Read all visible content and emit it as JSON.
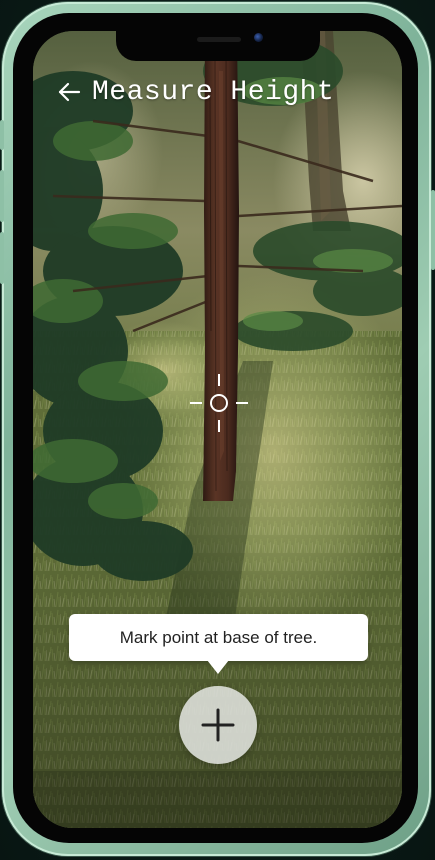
{
  "header": {
    "back_icon": "arrow-left-icon",
    "title": "Measure Height"
  },
  "camera": {
    "scene": "tree-trunk-in-grass",
    "crosshair_icon": "crosshair-icon"
  },
  "instruction": {
    "text": "Mark point at base of tree."
  },
  "add_point": {
    "icon": "plus-icon"
  },
  "colors": {
    "phone_frame": "#9fcdb3",
    "bubble_bg": "#ffffff",
    "bubble_text": "#222222",
    "button_bg": "#e0e2de",
    "icon_dark": "#222222",
    "header_text": "#ffffff"
  }
}
